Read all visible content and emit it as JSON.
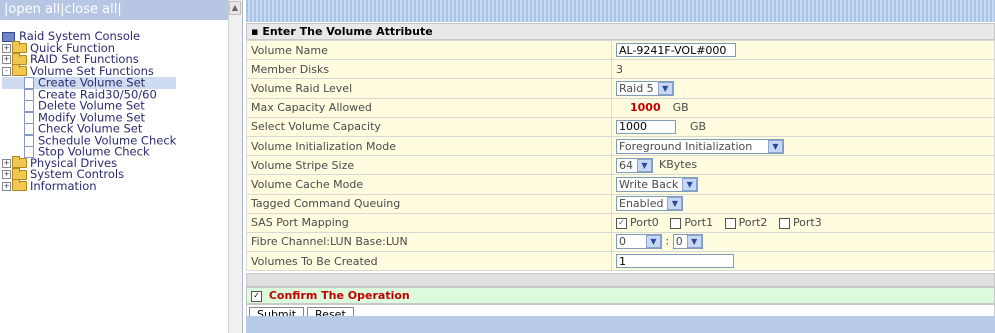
{
  "left": {
    "open_all": "open all",
    "sep1": "|",
    "close_all": "close all",
    "sep0": "|",
    "sep2": "|",
    "root": "Raid System Console",
    "items": [
      {
        "label": "Quick Function",
        "expand": "+"
      },
      {
        "label": "RAID Set Functions",
        "expand": "+"
      },
      {
        "label": "Volume Set Functions",
        "expand": "-"
      },
      {
        "label": "Physical Drives",
        "expand": "+"
      },
      {
        "label": "System Controls",
        "expand": "+"
      },
      {
        "label": "Information",
        "expand": "+"
      }
    ],
    "volume_children": [
      "Create Volume Set",
      "Create Raid30/50/60",
      "Delete Volume Set",
      "Modify Volume Set",
      "Check Volume Set",
      "Schedule Volume Check",
      "Stop Volume Check"
    ]
  },
  "form": {
    "header": "Enter The Volume Attribute",
    "bullet": "▪",
    "rows": {
      "volume_name": {
        "label": "Volume Name",
        "value": "AL-9241F-VOL#000"
      },
      "member_disks": {
        "label": "Member Disks",
        "value": "3"
      },
      "raid_level": {
        "label": "Volume Raid Level",
        "value": "Raid 5"
      },
      "max_capacity": {
        "label": "Max Capacity Allowed",
        "value": "1000",
        "unit": "GB"
      },
      "select_capacity": {
        "label": "Select Volume Capacity",
        "value": "1000",
        "unit": "GB"
      },
      "init_mode": {
        "label": "Volume Initialization Mode",
        "value": "Foreground Initialization"
      },
      "stripe_size": {
        "label": "Volume Stripe Size",
        "value": "64",
        "unit": "KBytes"
      },
      "cache_mode": {
        "label": "Volume Cache Mode",
        "value": "Write Back"
      },
      "tcq": {
        "label": "Tagged Command Queuing",
        "value": "Enabled"
      },
      "sas_port": {
        "label": "SAS Port Mapping",
        "ports": [
          "Port0",
          "Port1",
          "Port2",
          "Port3"
        ],
        "checked": [
          true,
          false,
          false,
          false
        ]
      },
      "fibre": {
        "label": "Fibre Channel:LUN Base:LUN",
        "base": "0",
        "sep": ":",
        "lun": "0"
      },
      "volumes_count": {
        "label": "Volumes To Be Created",
        "value": "1"
      }
    },
    "confirm_label": "Confirm The Operation",
    "submit": "Submit",
    "reset": "Reset"
  }
}
